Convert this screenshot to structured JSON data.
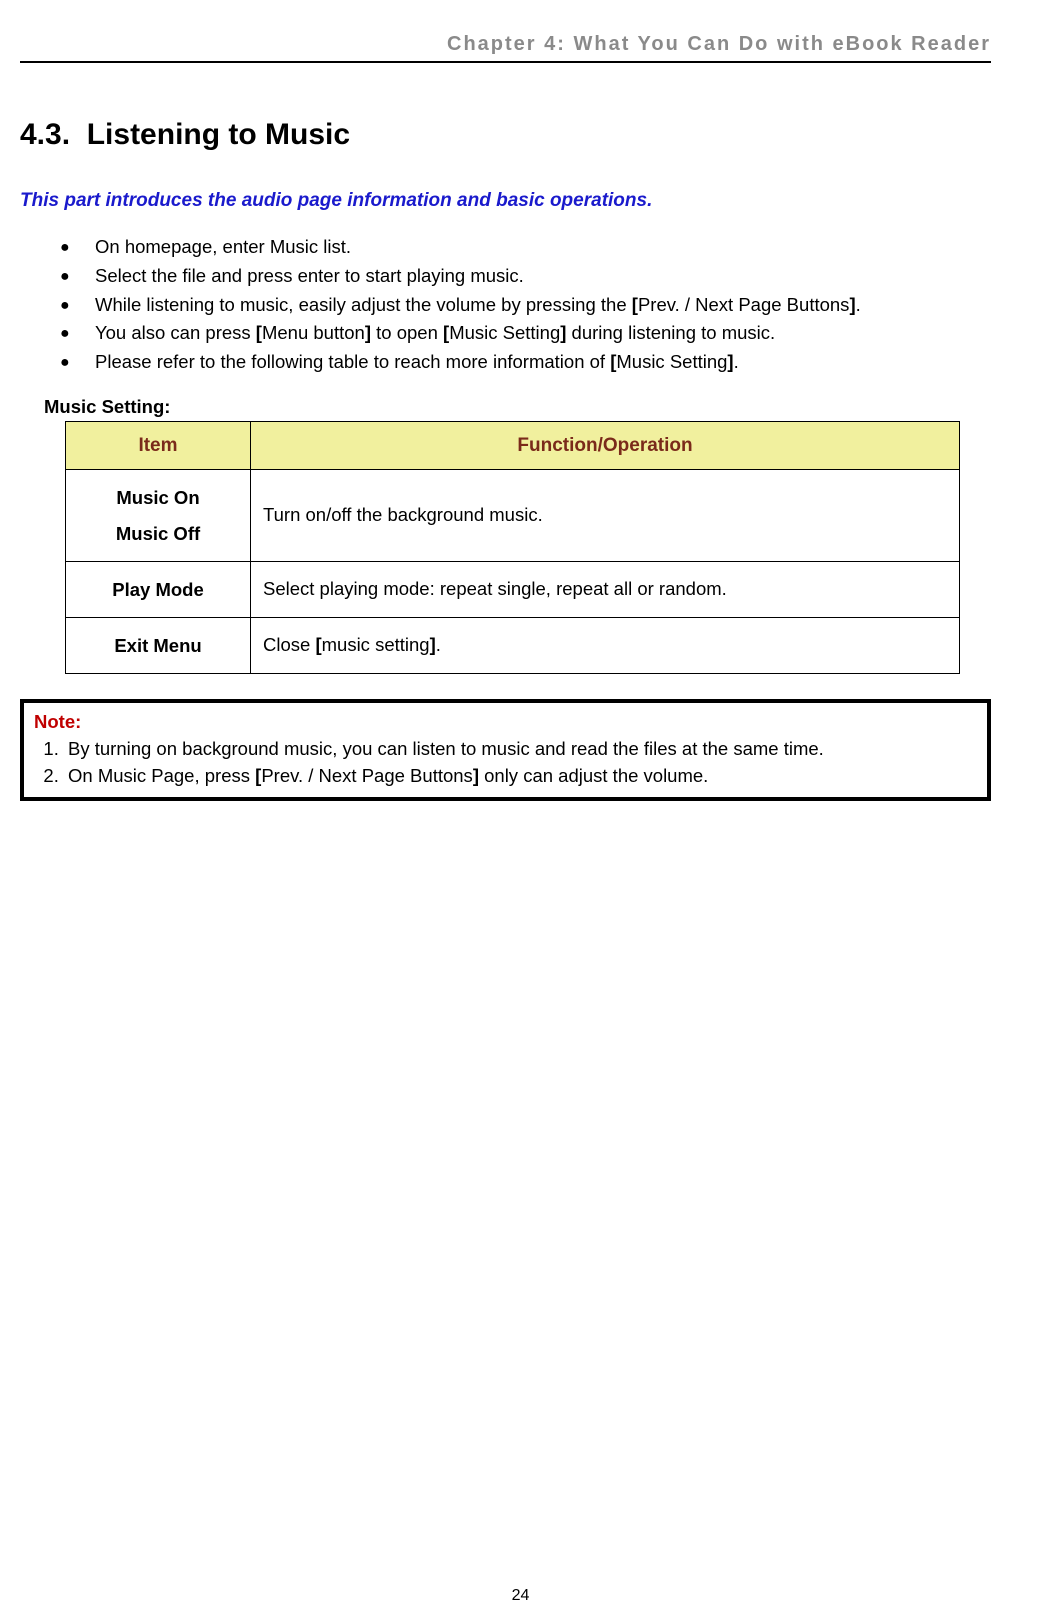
{
  "header": {
    "running_head": "Chapter 4: What You Can Do with eBook Reader"
  },
  "section": {
    "number": "4.3.",
    "title": "Listening to Music",
    "intro": "This part introduces the audio page information and basic operations."
  },
  "bullets": [
    "On homepage, enter Music list.",
    "Select the file and press enter to start playing music.",
    "While listening to music, easily adjust the volume by pressing the [Prev. / Next Page Buttons].",
    "You also can press [Menu button] to open [Music Setting] during listening to music.",
    "Please refer to the following table to reach more information of [Music Setting]."
  ],
  "table": {
    "caption": "Music Setting:",
    "head": {
      "item": "Item",
      "func": "Function/Operation"
    },
    "rows": [
      {
        "item_line1": "Music On",
        "item_line2": "Music Off",
        "func": "Turn on/off the background music."
      },
      {
        "item_line1": "Play Mode",
        "item_line2": "",
        "func": "Select playing mode: repeat single, repeat all or random."
      },
      {
        "item_line1": "Exit Menu",
        "item_line2": "",
        "func": "Close [music setting]."
      }
    ]
  },
  "note": {
    "label": "Note:",
    "items": [
      "By turning on background music, you can listen to music and read the files at the same time.",
      "On Music Page, press [Prev. / Next Page Buttons] only can adjust the volume."
    ]
  },
  "page_number": "24"
}
